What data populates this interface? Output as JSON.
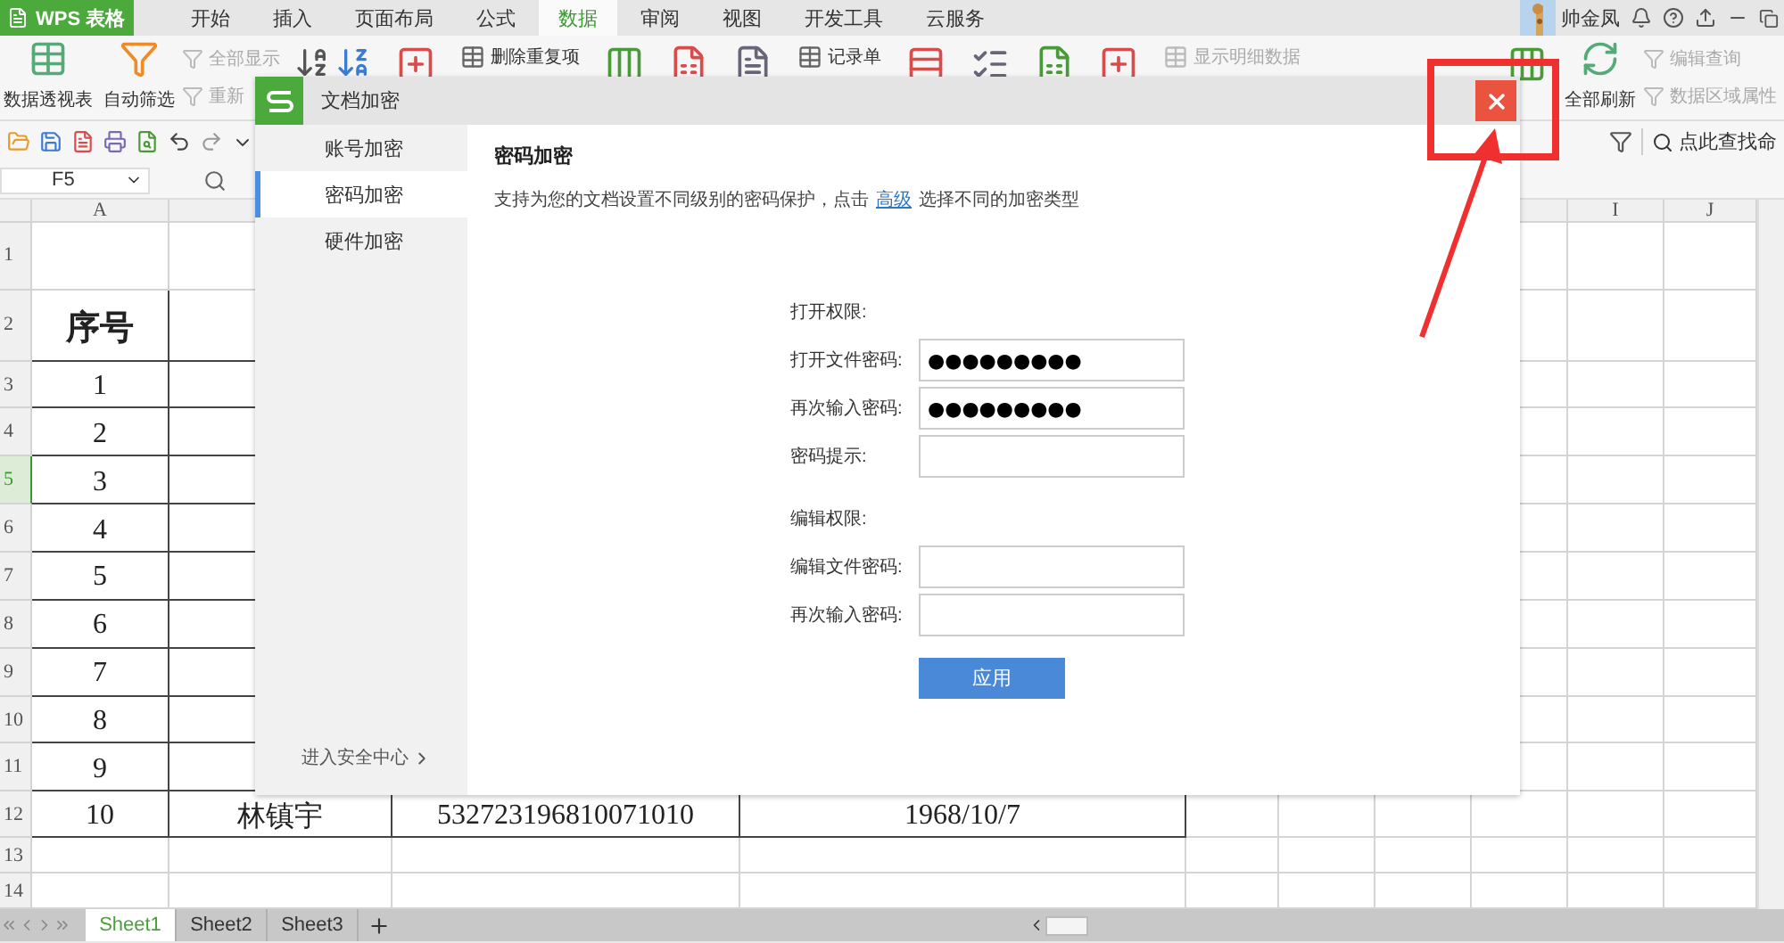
{
  "app_menu": {
    "label": "WPS 表格"
  },
  "menu_tabs": [
    {
      "label": "开始",
      "selected": false
    },
    {
      "label": "插入",
      "selected": false
    },
    {
      "label": "页面布局",
      "selected": false
    },
    {
      "label": "公式",
      "selected": false
    },
    {
      "label": "数据",
      "selected": true
    },
    {
      "label": "审阅",
      "selected": false
    },
    {
      "label": "视图",
      "selected": false
    },
    {
      "label": "开发工具",
      "selected": false
    },
    {
      "label": "云服务",
      "selected": false
    }
  ],
  "account": {
    "name": "帅金凤"
  },
  "ribbon": [
    {
      "kind": "large",
      "label": "数据透视表",
      "disabled": false
    },
    {
      "kind": "large",
      "label": "自动筛选",
      "disabled": false
    },
    {
      "kind": "stack",
      "items": [
        {
          "label": "全部显示",
          "disabled": true
        },
        {
          "label": "重新",
          "disabled": true
        }
      ]
    },
    {
      "kind": "sort"
    },
    {
      "kind": "icon"
    },
    {
      "kind": "top",
      "label": "删除重复项",
      "disabled": false
    },
    {
      "kind": "icon"
    },
    {
      "kind": "icon"
    },
    {
      "kind": "icon"
    },
    {
      "kind": "top",
      "label": "记录单",
      "disabled": false
    },
    {
      "kind": "icon"
    },
    {
      "kind": "icon"
    },
    {
      "kind": "icon"
    },
    {
      "kind": "icon"
    },
    {
      "kind": "top",
      "label": "显示明细数据",
      "disabled": true
    },
    {
      "kind": "icon"
    },
    {
      "kind": "large",
      "label": "全部刷新",
      "disabled": false
    },
    {
      "kind": "stack",
      "items": [
        {
          "label": "编辑查询",
          "disabled": true
        },
        {
          "label": "数据区域属性",
          "disabled": true
        }
      ]
    }
  ],
  "command_search": {
    "placeholder": "点此查找命"
  },
  "name_box": {
    "value": "F5"
  },
  "columns": [
    {
      "label": "A"
    },
    {},
    {},
    {},
    {},
    {},
    {},
    {},
    {
      "label": "I"
    },
    {
      "label": "J"
    }
  ],
  "rows": [
    {
      "header": "1",
      "selected": false,
      "kind": "blank",
      "cells": []
    },
    {
      "header": "2",
      "selected": false,
      "kind": "heading",
      "cells": [
        "序号"
      ]
    },
    {
      "header": "3",
      "selected": false,
      "kind": "table",
      "cells": [
        "1"
      ]
    },
    {
      "header": "4",
      "selected": false,
      "kind": "table",
      "cells": [
        "2"
      ]
    },
    {
      "header": "5",
      "selected": true,
      "kind": "table",
      "cells": [
        "3"
      ]
    },
    {
      "header": "6",
      "selected": false,
      "kind": "table",
      "cells": [
        "4"
      ]
    },
    {
      "header": "7",
      "selected": false,
      "kind": "table",
      "cells": [
        "5"
      ]
    },
    {
      "header": "8",
      "selected": false,
      "kind": "table",
      "cells": [
        "6"
      ]
    },
    {
      "header": "9",
      "selected": false,
      "kind": "table",
      "cells": [
        "7"
      ]
    },
    {
      "header": "10",
      "selected": false,
      "kind": "table",
      "cells": [
        "8"
      ]
    },
    {
      "header": "11",
      "selected": false,
      "kind": "table",
      "cells": [
        "9"
      ]
    },
    {
      "header": "12",
      "selected": false,
      "kind": "table",
      "cells": [
        "10",
        "林镇宇",
        "532723196810071010",
        "1968/10/7"
      ]
    },
    {
      "header": "13",
      "selected": false,
      "kind": "blank",
      "cells": []
    },
    {
      "header": "14",
      "selected": false,
      "kind": "blank",
      "cells": []
    }
  ],
  "sheet_tabs": [
    {
      "label": "Sheet1",
      "selected": true
    },
    {
      "label": "Sheet2",
      "selected": false
    },
    {
      "label": "Sheet3",
      "selected": false
    }
  ],
  "dialog": {
    "title": "文档加密",
    "nav": [
      {
        "label": "账号加密",
        "selected": false
      },
      {
        "label": "密码加密",
        "selected": true
      },
      {
        "label": "硬件加密",
        "selected": false
      }
    ],
    "footer_link": "进入安全中心",
    "heading": "密码加密",
    "description": "支持为您的文档设置不同级别的密码保护，点击",
    "link": "高级",
    "description_end": "选择不同的加密类型",
    "sections": [
      {
        "title": "打开权限:",
        "fields": [
          {
            "label": "打开文件密码:",
            "value": "●●●●●●●●●"
          },
          {
            "label": "再次输入密码:",
            "value": "●●●●●●●●●"
          },
          {
            "label": "密码提示:"
          }
        ]
      },
      {
        "title": "编辑权限:",
        "fields": [
          {
            "label": "编辑文件密码:"
          },
          {
            "label": "再次输入密码:"
          }
        ]
      }
    ],
    "apply_button": "应用"
  }
}
